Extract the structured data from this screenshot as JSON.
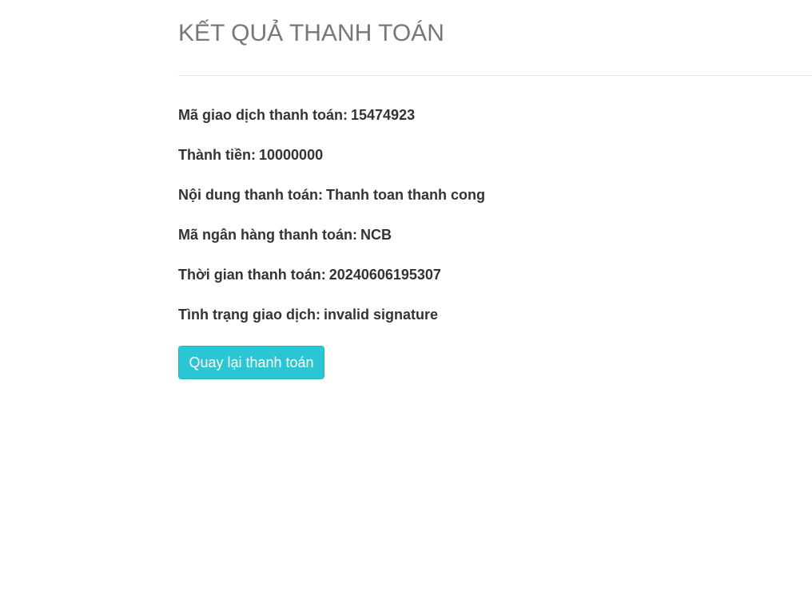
{
  "page": {
    "title": "KẾT QUẢ THANH TOÁN"
  },
  "result": {
    "rows": [
      {
        "label": "Mã giao dịch thanh toán:",
        "value": "15474923"
      },
      {
        "label": "Thành tiền:",
        "value": "10000000"
      },
      {
        "label": "Nội dung thanh toán:",
        "value": "Thanh toan thanh cong"
      },
      {
        "label": "Mã ngân hàng thanh toán:",
        "value": "NCB"
      },
      {
        "label": "Thời gian thanh toán:",
        "value": "20240606195307"
      },
      {
        "label": "Tình trạng giao dịch:",
        "value": "invalid signature"
      }
    ]
  },
  "actions": {
    "back_label": "Quay lại thanh toán"
  },
  "colors": {
    "button_bg": "#2ac6d4",
    "title": "#777777",
    "text": "#333333"
  }
}
